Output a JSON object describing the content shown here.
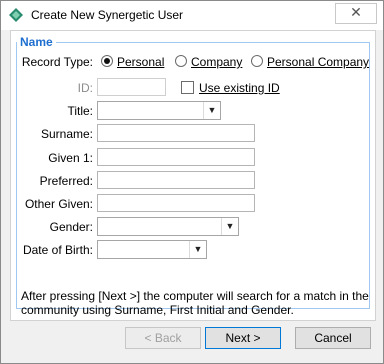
{
  "window": {
    "title": "Create New Synergetic User",
    "close_symbol": "✕"
  },
  "group": {
    "legend": "Name"
  },
  "record_type": {
    "label": "Record Type:",
    "options": [
      {
        "label": "Personal",
        "selected": true
      },
      {
        "label": "Company",
        "selected": false
      },
      {
        "label": "Personal Company",
        "selected": false
      }
    ]
  },
  "id_field": {
    "label": "ID:",
    "value": ""
  },
  "use_existing": {
    "label": "Use existing ID",
    "checked": false
  },
  "fields": {
    "title": {
      "label": "Title:",
      "value": ""
    },
    "surname": {
      "label": "Surname:",
      "value": ""
    },
    "given1": {
      "label": "Given 1:",
      "value": ""
    },
    "preferred": {
      "label": "Preferred:",
      "value": ""
    },
    "other_given": {
      "label": "Other Given:",
      "value": ""
    },
    "gender": {
      "label": "Gender:",
      "value": ""
    },
    "dob": {
      "label": "Date of Birth:",
      "value": ""
    }
  },
  "info": {
    "line1": "After pressing [Next >] the computer will search for a match in the",
    "line2": "community using Surname, First Initial and Gender."
  },
  "buttons": {
    "back": "< Back",
    "next": "Next >",
    "cancel": "Cancel"
  }
}
